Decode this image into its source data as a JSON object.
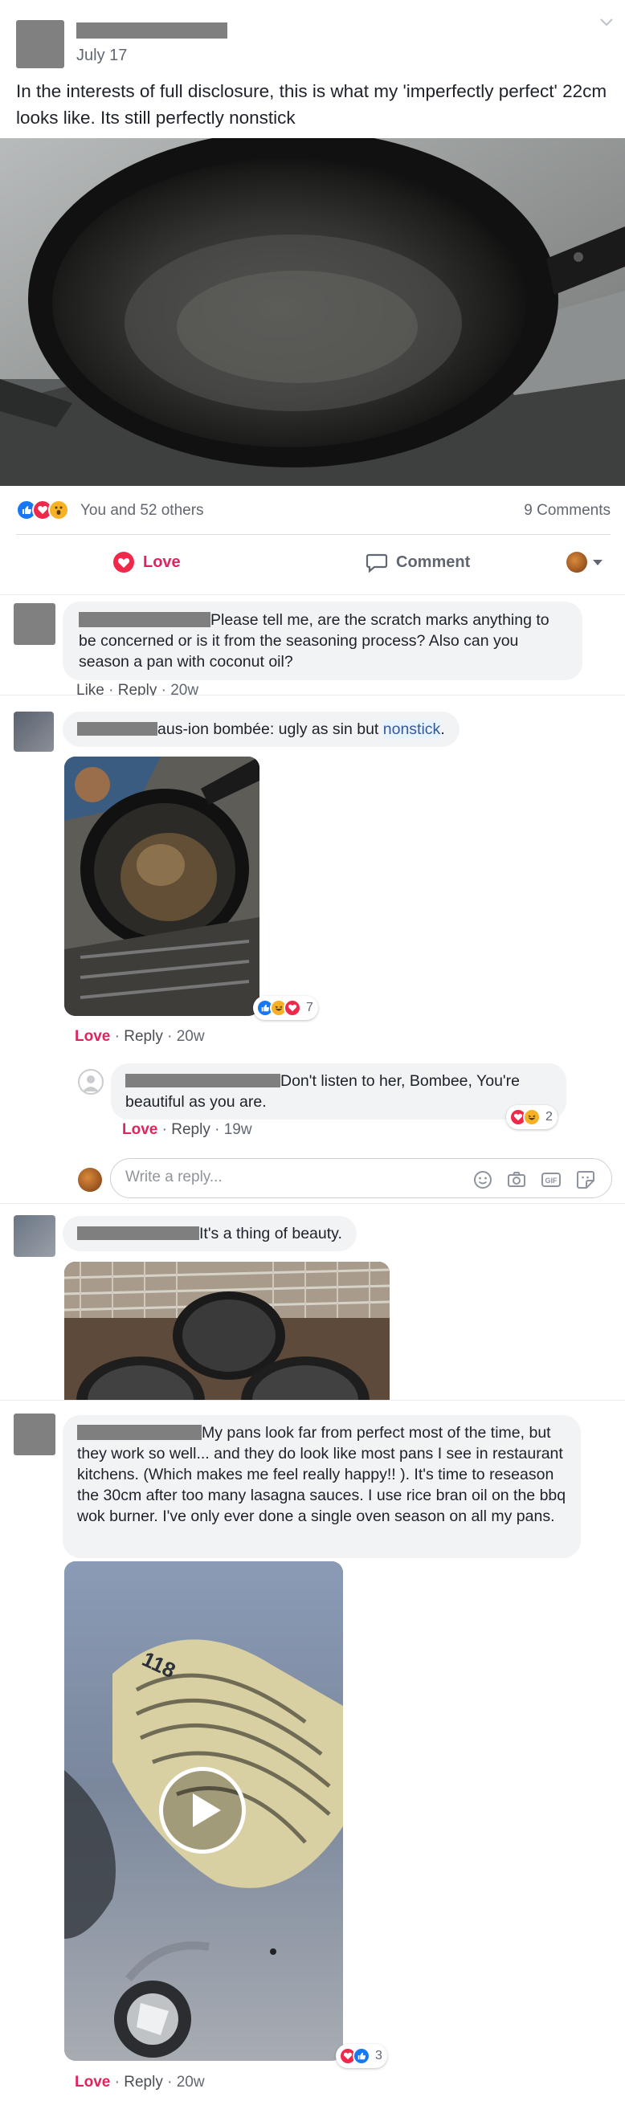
{
  "post": {
    "date": "July 17",
    "text": "In the interests of full disclosure, this is what my 'imperfectly perfect' 22cm looks like. Its still perfectly nonstick",
    "reactions_text": "You and 52 others",
    "comments_text": "9 Comments",
    "actions": {
      "love": "Love",
      "comment": "Comment"
    }
  },
  "comments": [
    {
      "text": "Please tell me, are the scratch marks anything to be concerned or is it from the seasoning process? Also can you season a pan with coconut oil?",
      "meta": {
        "like": "Like",
        "reply": "Reply",
        "time": "20w"
      }
    },
    {
      "name_fragment": "aus-ion bombée: ugly as sin but ",
      "link_text": "nonstick",
      "text_end": ".",
      "reaction_count": "7",
      "meta": {
        "love": "Love",
        "reply": "Reply",
        "time": "20w"
      },
      "reply": {
        "text": "Don't listen to her, Bombee, You're beautiful as you are.",
        "reaction_count": "2",
        "meta": {
          "love": "Love",
          "reply": "Reply",
          "time": "19w"
        }
      }
    },
    {
      "text": "It's a thing of beauty."
    },
    {
      "text": "My pans look far from perfect most of the time, but they work so well... and they do look like most pans I see in restaurant kitchens. (Which makes me feel really happy!! ). It's time to reseason the 30cm after too many lasagna sauces. I use rice bran oil on the bbq wok burner. I've only ever done a single oven season on all my pans.",
      "reaction_count": "3",
      "meta": {
        "love": "Love",
        "reply": "Reply",
        "time": "20w"
      }
    }
  ],
  "reply_box": {
    "placeholder": "Write a reply..."
  },
  "colors": {
    "love": "#e0245e",
    "like": "#1877f2",
    "haha": "#f7b125",
    "link_highlight": "#e7f3ff"
  },
  "icons": [
    "chevron-down-icon",
    "like-icon",
    "love-icon",
    "wow-icon",
    "haha-icon",
    "comment-icon",
    "camera-icon",
    "gif-icon",
    "sticker-icon",
    "emoji-icon",
    "play-icon"
  ]
}
